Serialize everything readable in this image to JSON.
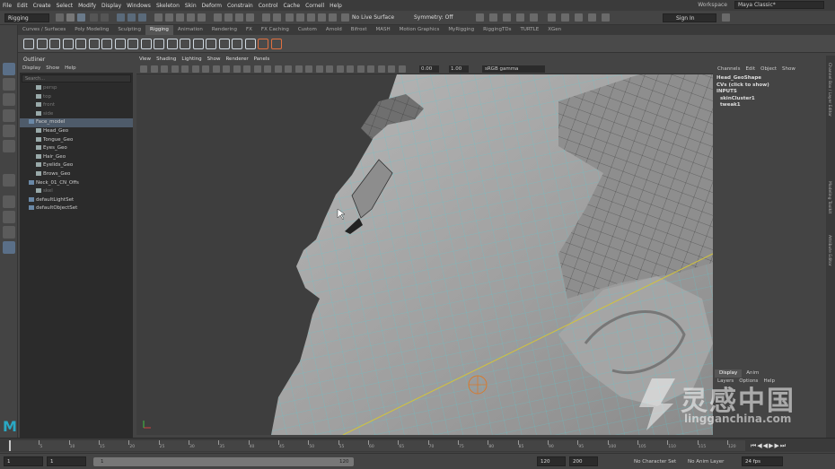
{
  "menubar": {
    "items": [
      "File",
      "Edit",
      "Create",
      "Select",
      "Modify",
      "Display",
      "Windows",
      "Skeleton",
      "Skin",
      "Deform",
      "Constrain",
      "Control",
      "Cache",
      "Cornell",
      "Help"
    ],
    "workspace_label": "Workspace",
    "workspace_value": "Maya Classic*"
  },
  "statusline": {
    "mode": "Rigging",
    "live_surface": "No Live Surface",
    "symmetry": "Symmetry: Off",
    "sign_in": "Sign In"
  },
  "shelf": {
    "tabs": [
      "Curves / Surfaces",
      "Poly Modeling",
      "Sculpting",
      "Rigging",
      "Animation",
      "Rendering",
      "FX",
      "FX Caching",
      "Custom",
      "Arnold",
      "Bifrost",
      "MASH",
      "Motion Graphics",
      "MyRigging",
      "RiggingTDs",
      "TURTLE",
      "XGen"
    ],
    "active_tab": "Rigging"
  },
  "outliner": {
    "title": "Outliner",
    "menu": [
      "Display",
      "Show",
      "Help"
    ],
    "search_placeholder": "Search...",
    "items": [
      {
        "label": "persp",
        "indent": 1,
        "faded": true
      },
      {
        "label": "top",
        "indent": 1,
        "faded": true
      },
      {
        "label": "front",
        "indent": 1,
        "faded": true
      },
      {
        "label": "side",
        "indent": 1,
        "faded": true
      },
      {
        "label": "Face_model",
        "indent": 0,
        "selected": true
      },
      {
        "label": "Head_Geo",
        "indent": 1
      },
      {
        "label": "Tongue_Geo",
        "indent": 1
      },
      {
        "label": "Eyes_Geo",
        "indent": 1
      },
      {
        "label": "Hair_Geo",
        "indent": 1
      },
      {
        "label": "Eyelids_Geo",
        "indent": 1
      },
      {
        "label": "Brows_Geo",
        "indent": 1
      },
      {
        "label": "Neck_01_CN_Offs",
        "indent": 0
      },
      {
        "label": "skel",
        "indent": 1,
        "faded": true
      },
      {
        "label": "defaultLightSet",
        "indent": 0
      },
      {
        "label": "defaultObjectSet",
        "indent": 0
      }
    ]
  },
  "viewport": {
    "menu": [
      "View",
      "Shading",
      "Lighting",
      "Show",
      "Renderer",
      "Panels"
    ],
    "exposure": "0.00",
    "gamma": "1.00",
    "color_space": "sRGB gamma"
  },
  "channelbox": {
    "menu": [
      "Channels",
      "Edit",
      "Object",
      "Show"
    ],
    "shape": "Head_GeoShape",
    "cvs": "CVs (click to show)",
    "inputs_label": "INPUTS",
    "inputs": [
      "skinCluster1",
      "tweak1"
    ],
    "side_tabs": [
      "Channel Box / Layer Editor",
      "Modeling Toolkit",
      "Attribute Editor"
    ]
  },
  "layereditor": {
    "tabs": [
      "Display",
      "Anim"
    ],
    "active_tab": "Display",
    "menu": [
      "Layers",
      "Options",
      "Help"
    ]
  },
  "timeslider": {
    "ticks": [
      "5",
      "10",
      "15",
      "20",
      "25",
      "30",
      "35",
      "40",
      "45",
      "50",
      "55",
      "60",
      "65",
      "70",
      "75",
      "80",
      "85",
      "90",
      "95",
      "100",
      "105",
      "110",
      "115",
      "120"
    ]
  },
  "rangeslider": {
    "start": "1",
    "current": "1",
    "range_start": "1",
    "range_end": "120",
    "end1": "120",
    "end2": "200",
    "character_set": "No Character Set",
    "anim_layer": "No Anim Layer",
    "fps": "24 fps"
  },
  "watermark": {
    "cn": "灵感中国",
    "en": "lingganchina.com"
  },
  "colors": {
    "wire": "#4fd0d8",
    "accent": "#5c6c7a",
    "mesh": "#9a9a9a"
  }
}
